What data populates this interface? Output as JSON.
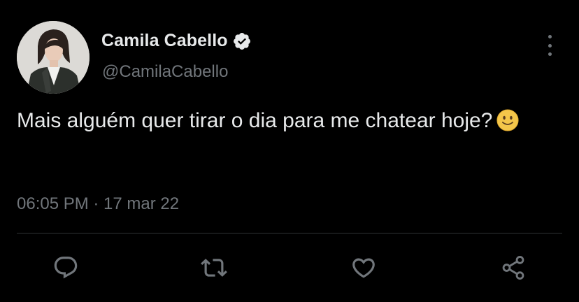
{
  "author": {
    "display_name": "Camila Cabello",
    "handle": "@CamilaCabello",
    "verified": true
  },
  "tweet": {
    "text": "Mais alguém quer tirar o dia para me chatear hoje?",
    "emoji": "slightly-smiling-face",
    "timestamp": "06:05 PM · 17 mar 22"
  },
  "actions": [
    "reply-icon",
    "retweet-icon",
    "like-icon",
    "share-icon"
  ],
  "colors": {
    "background": "#000000",
    "primary_text": "#e7e9ea",
    "secondary_text": "#71767b",
    "divider": "#2f3336"
  }
}
